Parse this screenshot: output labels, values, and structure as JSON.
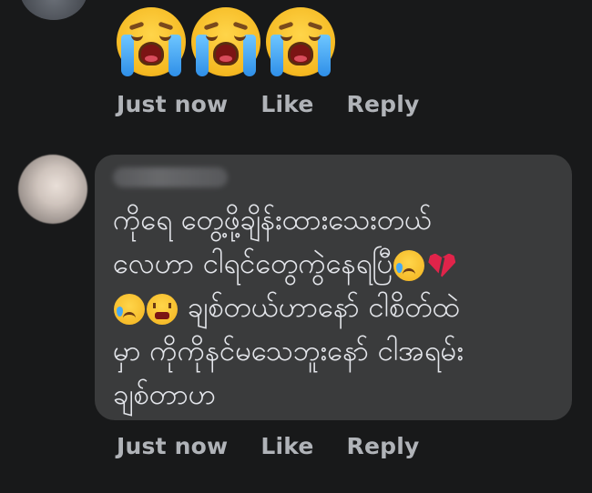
{
  "comment_1": {
    "reaction_emojis": [
      "loudly-crying-face-emoji",
      "loudly-crying-face-emoji",
      "loudly-crying-face-emoji"
    ],
    "time": "Just now",
    "like_label": "Like",
    "reply_label": "Reply"
  },
  "comment_2": {
    "text_lines": [
      "ကိုရေ တွေ့ဖို့ချိန်းထားသေးတယ်",
      "လေဟာ ငါရင်တွေကွဲနေရပြီ",
      "ချစ်တယ်ဟာနော် ငါစိတ်ထဲ",
      "မှာ ကိုကိုနင်မသေဘူးနော် ငါအရမ်း",
      "ချစ်တာဟ"
    ],
    "inline_emojis": [
      "sad-but-relieved-face-emoji",
      "broken-heart-emoji",
      "disappointed-relieved-face-emoji",
      "tired-face-emoji"
    ],
    "time": "Just now",
    "like_label": "Like",
    "reply_label": "Reply"
  },
  "colors": {
    "background": "#18191a",
    "bubble": "#3a3b3c",
    "text": "#e4e6eb",
    "action_text": "#b0b3b8"
  }
}
